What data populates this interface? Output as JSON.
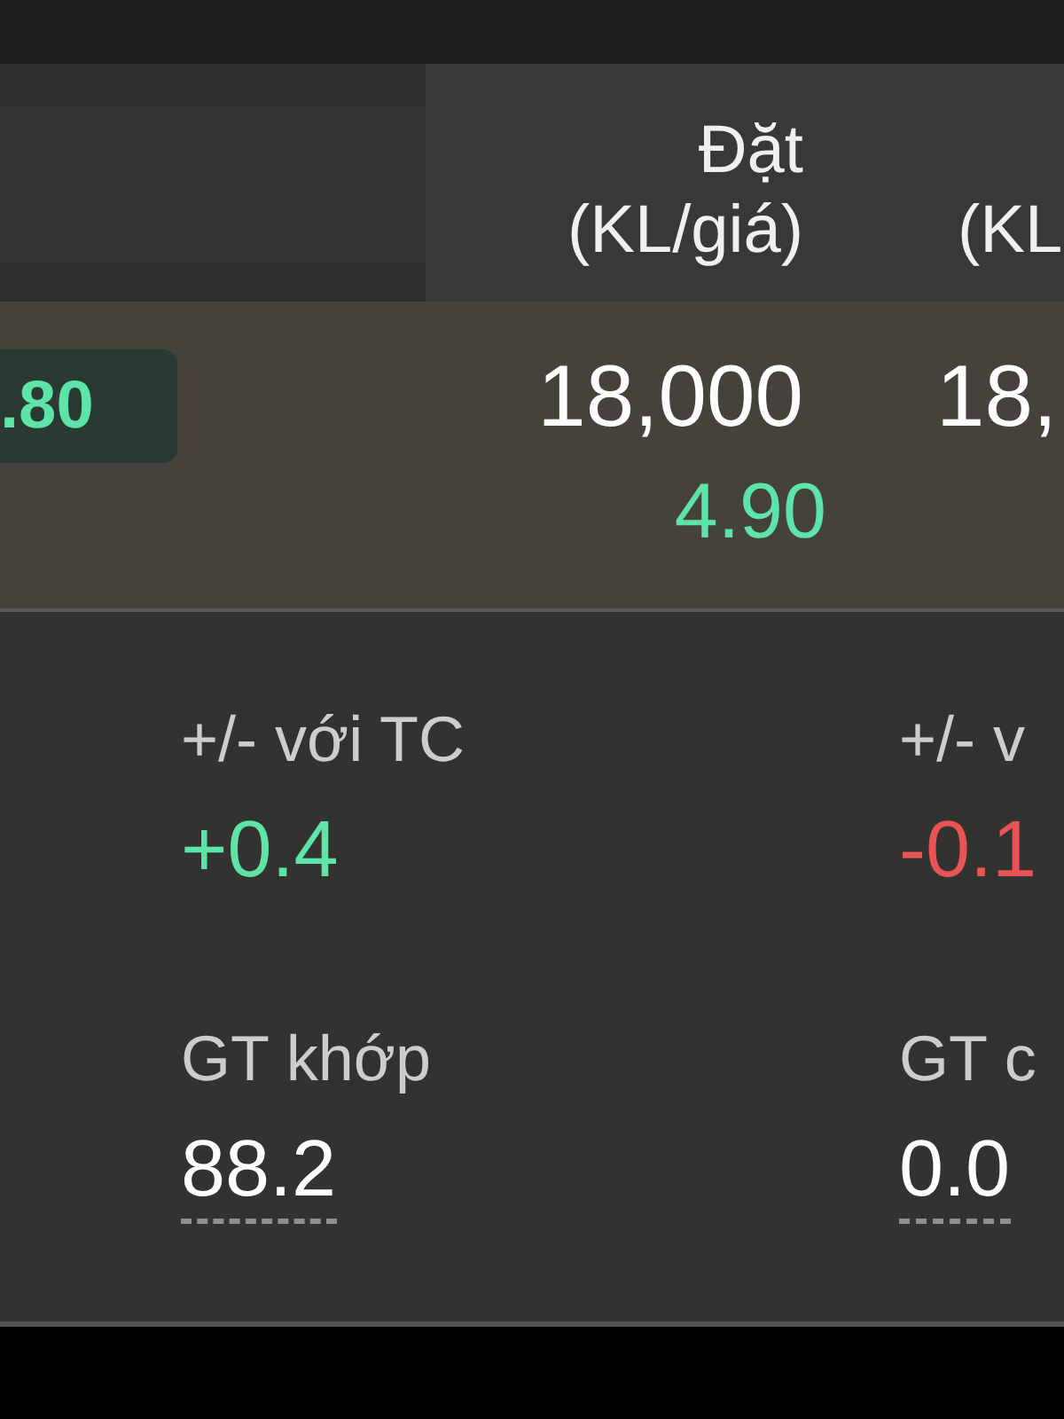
{
  "header": {
    "columns": [
      {
        "lines": [
          "Đặt",
          "(KL/giá)"
        ]
      },
      {
        "lines": [
          "(KL"
        ]
      }
    ]
  },
  "row": {
    "badge": {
      "text": ".80",
      "color": "#5ee3a9"
    },
    "cells": [
      {
        "volume": "18,000",
        "price": "4.90",
        "color": "#5ee3a9"
      },
      {
        "volume": "18,"
      }
    ]
  },
  "stats": [
    {
      "label": "+/- với TC",
      "value": "+0.4",
      "color": "#5ee3a9",
      "underlined": false
    },
    {
      "label": "+/- v",
      "value": "-0.1",
      "color": "#e85454",
      "underlined": false
    },
    {
      "label": "GT khớp",
      "value": "88.2",
      "color": "#ffffff",
      "underlined": true
    },
    {
      "label": "GT c",
      "value": "0.0",
      "color": "#ffffff",
      "underlined": true
    }
  ]
}
